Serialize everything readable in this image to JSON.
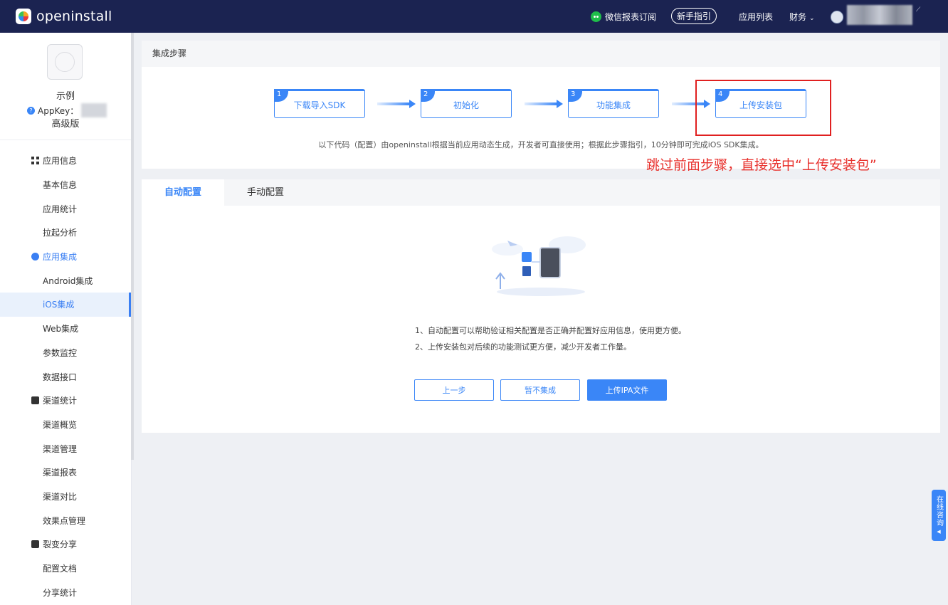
{
  "topbar": {
    "brand": "openinstall",
    "wechat_report": "微信报表订阅",
    "new_guide": "新手指引",
    "app_list": "应用列表",
    "finance": "财务"
  },
  "sidebar": {
    "app_name": "示例",
    "appkey_label": "AppKey：",
    "plan": "高级版",
    "menu": [
      {
        "label": "应用信息",
        "type": "group",
        "icon": "grid-icon"
      },
      {
        "label": "基本信息",
        "type": "sub"
      },
      {
        "label": "应用统计",
        "type": "sub"
      },
      {
        "label": "拉起分析",
        "type": "sub"
      },
      {
        "label": "应用集成",
        "type": "group",
        "icon": "integration-icon"
      },
      {
        "label": "Android集成",
        "type": "sub"
      },
      {
        "label": "iOS集成",
        "type": "sub",
        "active": true
      },
      {
        "label": "Web集成",
        "type": "sub"
      },
      {
        "label": "参数监控",
        "type": "sub"
      },
      {
        "label": "数据接口",
        "type": "sub"
      },
      {
        "label": "渠道统计",
        "type": "group",
        "icon": "chart-icon"
      },
      {
        "label": "渠道概览",
        "type": "sub"
      },
      {
        "label": "渠道管理",
        "type": "sub"
      },
      {
        "label": "渠道报表",
        "type": "sub"
      },
      {
        "label": "渠道对比",
        "type": "sub"
      },
      {
        "label": "效果点管理",
        "type": "sub"
      },
      {
        "label": "裂变分享",
        "type": "group",
        "icon": "share-icon"
      },
      {
        "label": "配置文档",
        "type": "sub"
      },
      {
        "label": "分享统计",
        "type": "sub"
      }
    ]
  },
  "steps": {
    "title": "集成步骤",
    "items": [
      {
        "num": "1",
        "label": "下载导入SDK"
      },
      {
        "num": "2",
        "label": "初始化"
      },
      {
        "num": "3",
        "label": "功能集成"
      },
      {
        "num": "4",
        "label": "上传安装包"
      }
    ],
    "note": "以下代码（配置）由openinstall根据当前应用动态生成，开发者可直接使用；根据此步骤指引，10分钟即可完成iOS SDK集成。"
  },
  "annotation": "跳过前面步骤，直接选中“上传安装包”",
  "config": {
    "tabs": [
      "自动配置",
      "手动配置"
    ],
    "tips": [
      "1、自动配置可以帮助验证相关配置是否正确并配置好应用信息，使用更方便。",
      "2、上传安装包对后续的功能测试更方便，减少开发者工作量。"
    ],
    "buttons": {
      "prev": "上一步",
      "skip": "暂不集成",
      "upload": "上传IPA文件"
    }
  },
  "consult": "在线咨询",
  "colors": {
    "accent": "#3a86f7",
    "topbar": "#1b2351",
    "annotation": "#e8322e"
  }
}
